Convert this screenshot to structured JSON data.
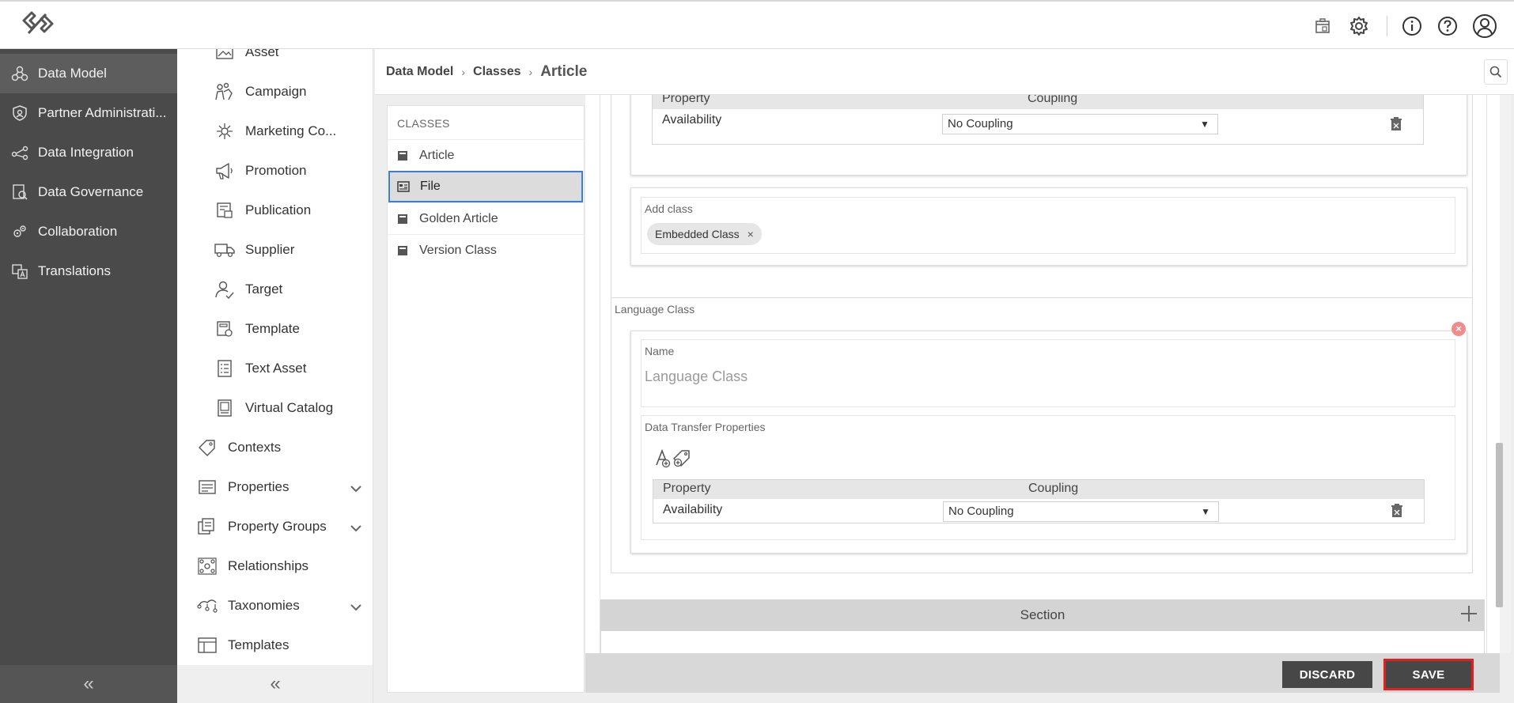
{
  "left_nav": {
    "items": [
      {
        "label": "Data Model",
        "icon": "data-model-icon",
        "active": true
      },
      {
        "label": "Partner Administrati...",
        "icon": "shield-icon",
        "active": false
      },
      {
        "label": "Data Integration",
        "icon": "integration-icon",
        "active": false
      },
      {
        "label": "Data Governance",
        "icon": "governance-icon",
        "active": false
      },
      {
        "label": "Collaboration",
        "icon": "collaboration-icon",
        "active": false
      },
      {
        "label": "Translations",
        "icon": "translations-icon",
        "active": false
      }
    ],
    "collapse_glyph": "«"
  },
  "sub_nav": {
    "items": [
      {
        "label": "Asset",
        "icon": "asset-icon",
        "level": 2
      },
      {
        "label": "Campaign",
        "icon": "campaign-icon",
        "level": 2
      },
      {
        "label": "Marketing Co...",
        "icon": "marketing-icon",
        "level": 2
      },
      {
        "label": "Promotion",
        "icon": "megaphone-icon",
        "level": 2
      },
      {
        "label": "Publication",
        "icon": "publication-icon",
        "level": 2
      },
      {
        "label": "Supplier",
        "icon": "truck-icon",
        "level": 2
      },
      {
        "label": "Target",
        "icon": "target-user-icon",
        "level": 2
      },
      {
        "label": "Template",
        "icon": "template-icon",
        "level": 2
      },
      {
        "label": "Text Asset",
        "icon": "text-asset-icon",
        "level": 2
      },
      {
        "label": "Virtual Catalog",
        "icon": "catalog-icon",
        "level": 2
      },
      {
        "label": "Contexts",
        "icon": "tag-icon",
        "level": 1
      },
      {
        "label": "Properties",
        "icon": "properties-icon",
        "level": 1,
        "expandable": true
      },
      {
        "label": "Property Groups",
        "icon": "property-groups-icon",
        "level": 1,
        "expandable": true
      },
      {
        "label": "Relationships",
        "icon": "relationships-icon",
        "level": 1
      },
      {
        "label": "Taxonomies",
        "icon": "taxonomies-icon",
        "level": 1,
        "expandable": true
      },
      {
        "label": "Templates",
        "icon": "templates-icon",
        "level": 1
      }
    ],
    "collapse_glyph": "«"
  },
  "breadcrumb": {
    "items": [
      "Data Model",
      "Classes"
    ],
    "current": "Article",
    "separator": "›"
  },
  "classes_panel": {
    "title": "CLASSES",
    "items": [
      {
        "label": "Article",
        "selected": false
      },
      {
        "label": "File",
        "selected": true
      },
      {
        "label": "Golden Article",
        "selected": false
      },
      {
        "label": "Version Class",
        "selected": false
      }
    ]
  },
  "main": {
    "top_table": {
      "header_property": "Property",
      "header_coupling": "Coupling",
      "row_property": "Availability",
      "row_coupling": "No Coupling"
    },
    "add_class": {
      "label": "Add class",
      "chip": "Embedded Class",
      "chip_remove": "×"
    },
    "language_class": {
      "section_label": "Language Class",
      "name_label": "Name",
      "name_value": "Language Class",
      "dtp_label": "Data Transfer Properties",
      "table": {
        "header_property": "Property",
        "header_coupling": "Coupling",
        "row_property": "Availability",
        "row_coupling": "No Coupling"
      },
      "remove_glyph": "×"
    },
    "section_bar": {
      "label": "Section"
    }
  },
  "actions": {
    "discard": "DISCARD",
    "save": "SAVE"
  },
  "colors": {
    "nav_bg": "#4a4a4a",
    "selection_border": "#3b7dd8",
    "save_highlight": "#e01f1f",
    "button_bg": "#474747"
  }
}
